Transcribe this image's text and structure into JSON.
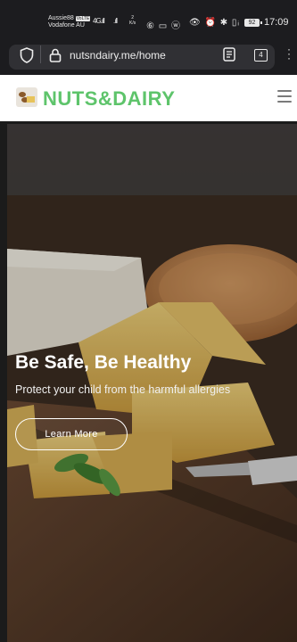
{
  "status_bar": {
    "carrier_line1": "Aussie88",
    "volte": "VoLTE",
    "carrier_line2": "Vodafone AU",
    "signal1": "4G.ıll",
    "signal2": ".ıll",
    "speed_value": "2",
    "speed_unit": "K/s",
    "icons_left": "⑥ ▭ ⓦ",
    "icons_right": "👁 ⏰ ✱ ▯ᵢ",
    "battery": "92",
    "time": "17:09"
  },
  "browser": {
    "url": "nutsndairy.me/home",
    "tab_count": "4"
  },
  "site": {
    "brand": "NUTS&DAIRY"
  },
  "hero": {
    "title": "Be Safe, Be Healthy",
    "subtitle": "Protect your child from the harmful allergies",
    "button_label": "Learn More"
  }
}
